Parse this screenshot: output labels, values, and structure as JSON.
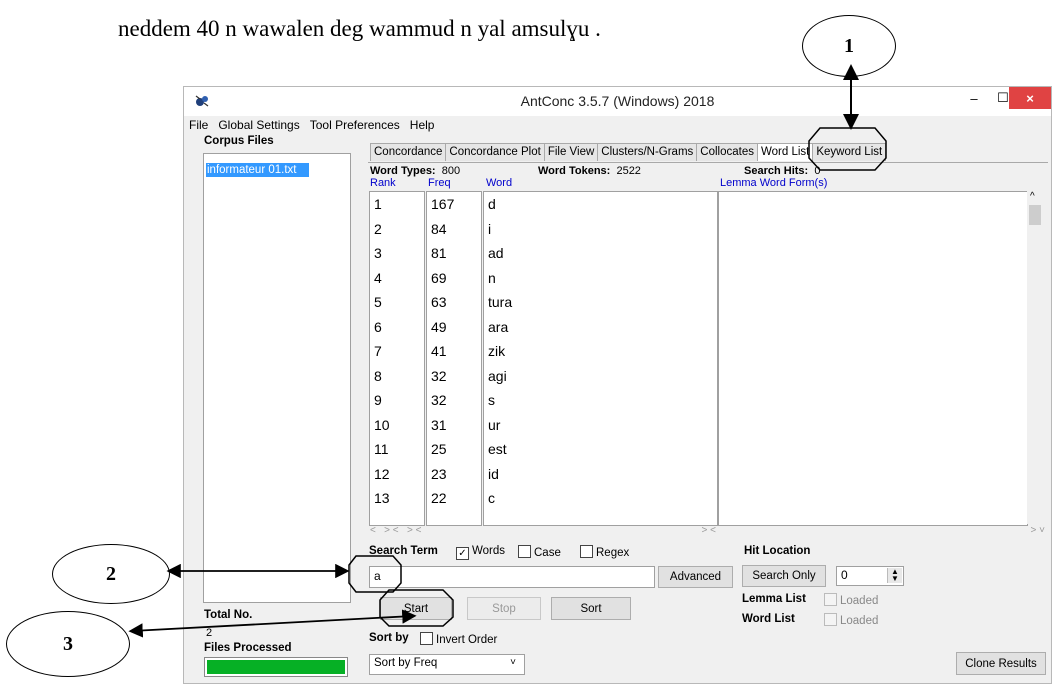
{
  "caption": "neddem 40 n wawalen deg wammud n yal amsulɣu .",
  "callouts": [
    "1",
    "2",
    "3"
  ],
  "window": {
    "title": "AntConc 3.5.7 (Windows) 2018",
    "controls": {
      "minimize": "–",
      "maximize": "☐",
      "close": "×"
    }
  },
  "menu": [
    "File",
    "Global Settings",
    "Tool Preferences",
    "Help"
  ],
  "left": {
    "corpus_label": "Corpus Files",
    "files": [
      "informateur 01.txt"
    ],
    "total_label": "Total No.",
    "total_value": "2",
    "processed_label": "Files Processed",
    "progress": 1.0
  },
  "tabs": [
    "Concordance",
    "Concordance Plot",
    "File View",
    "Clusters/N-Grams",
    "Collocates",
    "Word List",
    "Keyword List"
  ],
  "active_tab": "Word List",
  "stats": {
    "types_label": "Word Types:",
    "types_value": "800",
    "tokens_label": "Word Tokens:",
    "tokens_value": "2522",
    "hits_label": "Search Hits:",
    "hits_value": "0"
  },
  "columns": {
    "rank": "Rank",
    "freq": "Freq",
    "word": "Word",
    "lemma": "Lemma Word Form(s)"
  },
  "rows": [
    {
      "rank": "1",
      "freq": "167",
      "word": "d"
    },
    {
      "rank": "2",
      "freq": "84",
      "word": "i"
    },
    {
      "rank": "3",
      "freq": "81",
      "word": "ad"
    },
    {
      "rank": "4",
      "freq": "69",
      "word": "n"
    },
    {
      "rank": "5",
      "freq": "63",
      "word": "tura"
    },
    {
      "rank": "6",
      "freq": "49",
      "word": "ara"
    },
    {
      "rank": "7",
      "freq": "41",
      "word": "zik"
    },
    {
      "rank": "8",
      "freq": "32",
      "word": "agi"
    },
    {
      "rank": "9",
      "freq": "32",
      "word": "s"
    },
    {
      "rank": "10",
      "freq": "31",
      "word": "ur"
    },
    {
      "rank": "11",
      "freq": "25",
      "word": "est"
    },
    {
      "rank": "12",
      "freq": "23",
      "word": "id"
    },
    {
      "rank": "13",
      "freq": "22",
      "word": "c"
    }
  ],
  "search": {
    "label": "Search Term",
    "words_label": "Words",
    "words_checked": "✓",
    "case_label": "Case",
    "regex_label": "Regex",
    "value": "a",
    "advanced": "Advanced",
    "start": "Start",
    "stop": "Stop",
    "sort": "Sort"
  },
  "hit": {
    "label": "Hit Location",
    "search_only": "Search Only",
    "value": "0",
    "lemma_list_label": "Lemma List",
    "word_list_label": "Word List",
    "loaded_label": "Loaded"
  },
  "sort": {
    "label": "Sort by",
    "invert_label": "Invert Order",
    "selected": "Sort by Freq",
    "clone": "Clone Results"
  }
}
